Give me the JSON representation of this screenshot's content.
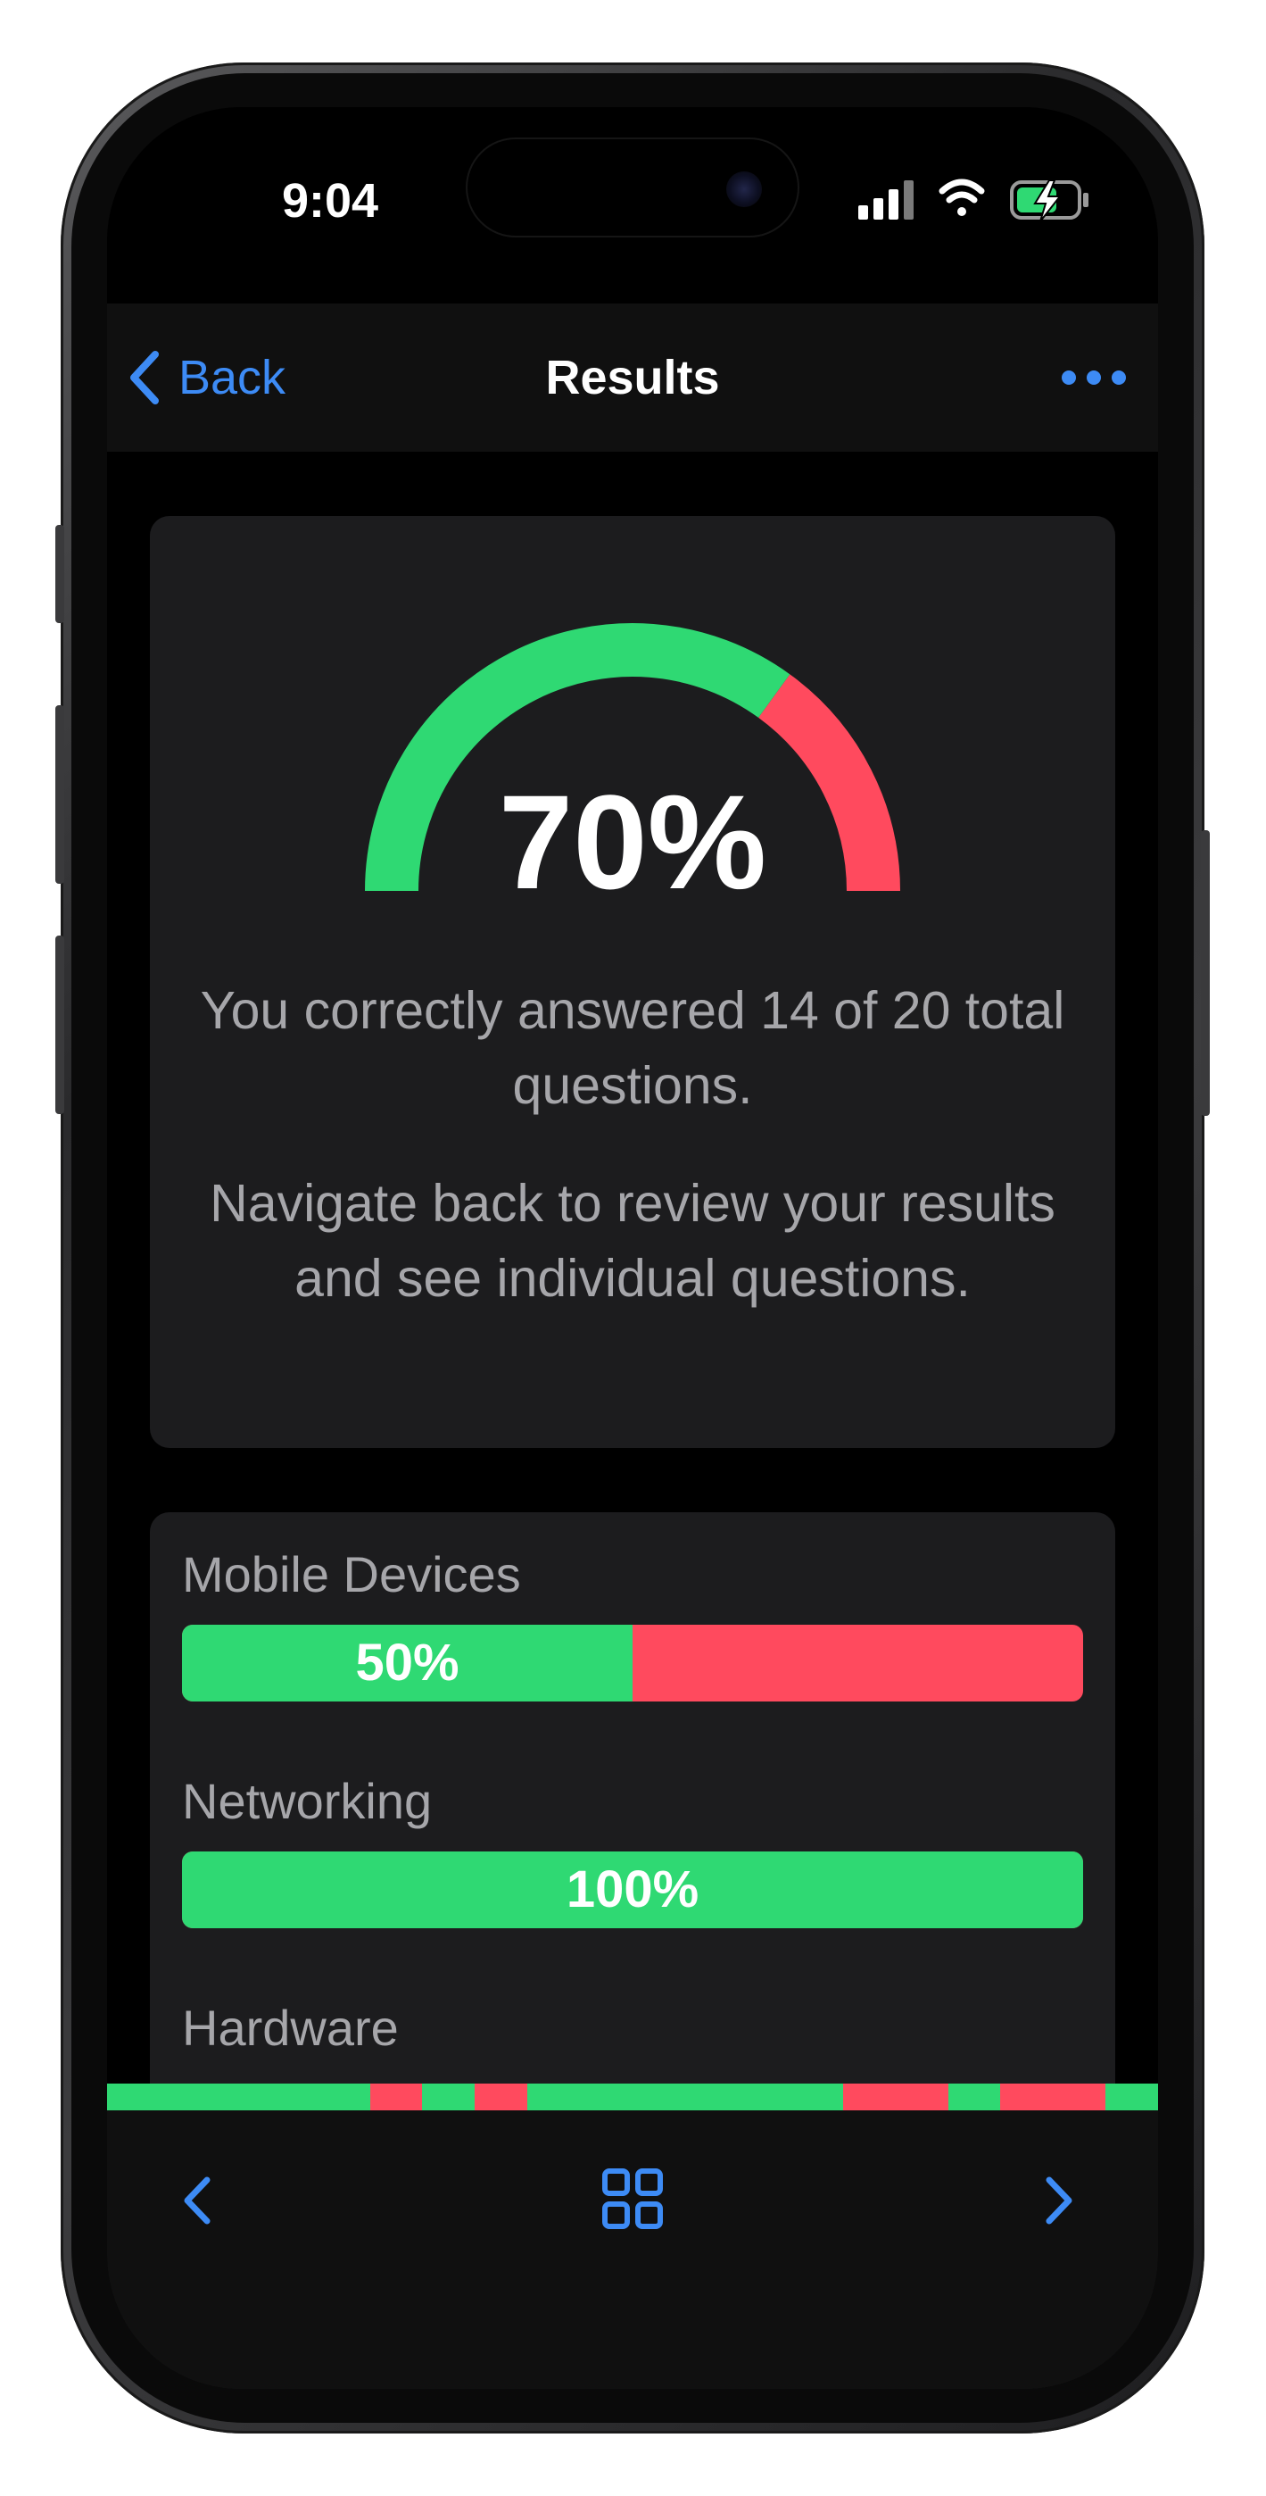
{
  "status_bar": {
    "time": "9:04"
  },
  "nav": {
    "back_label": "Back",
    "title": "Results"
  },
  "score": {
    "percent_label": "70%",
    "correct_fraction": 0.7,
    "summary": "You correctly answered 14 of 20 total questions.",
    "hint": "Navigate back to review your results and see individual questions."
  },
  "categories": [
    {
      "name": "Mobile Devices",
      "percent_label": "50%",
      "fraction": 0.5
    },
    {
      "name": "Networking",
      "percent_label": "100%",
      "fraction": 1.0
    },
    {
      "name": "Hardware"
    }
  ],
  "question_strip": [
    "correct",
    "correct",
    "correct",
    "correct",
    "correct",
    "wrong",
    "correct",
    "wrong",
    "correct",
    "correct",
    "correct",
    "correct",
    "correct",
    "correct",
    "wrong",
    "wrong",
    "correct",
    "wrong",
    "wrong",
    "correct"
  ],
  "colors": {
    "correct": "#2fd973",
    "wrong": "#ff4a5e",
    "accent": "#3d8bf5",
    "background": "#000000",
    "card": "#1c1c1e"
  },
  "icons": {
    "back": "chevron-left-icon",
    "more": "ellipsis-icon",
    "prev": "chevron-left-icon",
    "grid": "grid-icon",
    "next": "chevron-right-icon"
  }
}
